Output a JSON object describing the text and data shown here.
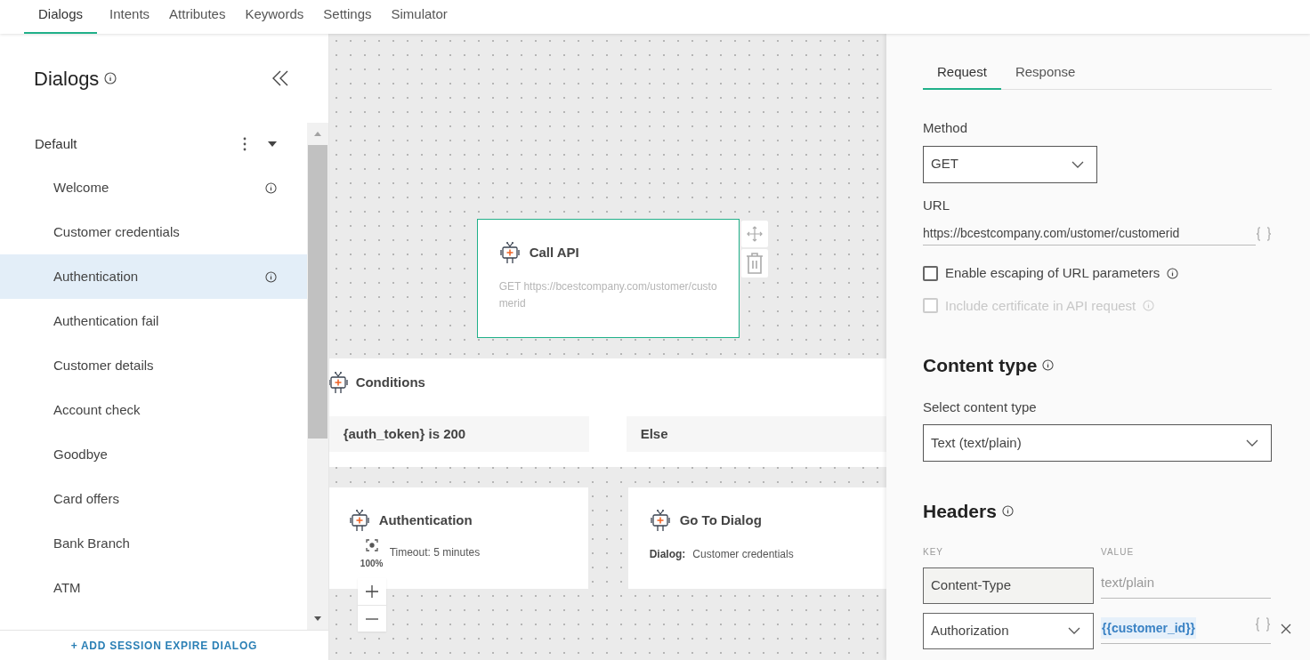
{
  "top_tabs": [
    {
      "label": "Dialogs",
      "selected": true
    },
    {
      "label": "Intents",
      "selected": false
    },
    {
      "label": "Attributes",
      "selected": false
    },
    {
      "label": "Keywords",
      "selected": false
    },
    {
      "label": "Settings",
      "selected": false
    },
    {
      "label": "Simulator",
      "selected": false
    }
  ],
  "sidebar": {
    "title": "Dialogs",
    "group": {
      "label": "Default",
      "expanded": true
    },
    "items": [
      {
        "label": "Welcome",
        "info": true,
        "selected": false
      },
      {
        "label": "Customer credentials",
        "info": false,
        "selected": false
      },
      {
        "label": "Authentication",
        "info": true,
        "selected": true
      },
      {
        "label": "Authentication fail",
        "info": false,
        "selected": false
      },
      {
        "label": "Customer details",
        "info": false,
        "selected": false
      },
      {
        "label": "Account check",
        "info": false,
        "selected": false
      },
      {
        "label": "Goodbye",
        "info": false,
        "selected": false
      },
      {
        "label": "Card offers",
        "info": false,
        "selected": false
      },
      {
        "label": "Bank Branch",
        "info": false,
        "selected": false
      },
      {
        "label": "ATM",
        "info": false,
        "selected": false
      }
    ],
    "add_button": "+ ADD SESSION EXPIRE DIALOG"
  },
  "canvas": {
    "nodes": [
      {
        "kind": "action",
        "title": "Call API",
        "text": "GET https://bcestcompany.com/ustomer/customerid",
        "selected": true
      },
      {
        "kind": "conditions",
        "title": "Conditions",
        "branches": [
          "{auth_token} is 200",
          "Else"
        ]
      },
      {
        "kind": "detail",
        "title": "Authentication",
        "text": "Timeout: 5 minutes"
      },
      {
        "kind": "goto",
        "title": "Go To Dialog",
        "label": "Dialog:",
        "value": "Customer credentials"
      }
    ],
    "zoom": "100%"
  },
  "panel": {
    "tabs": [
      {
        "label": "Request",
        "selected": true
      },
      {
        "label": "Response",
        "selected": false
      }
    ],
    "method": {
      "label": "Method",
      "value": "GET"
    },
    "url": {
      "label": "URL",
      "value": "https://bcestcompany.com/ustomer/customerid"
    },
    "options": [
      {
        "label": "Enable escaping of URL parameters",
        "checked": false,
        "disabled": false
      },
      {
        "label": "Include certificate in API request",
        "checked": false,
        "disabled": true
      }
    ],
    "content_type": {
      "heading": "Content type",
      "label": "Select content type",
      "value": "Text (text/plain)"
    },
    "headers": {
      "heading": "Headers",
      "columns": [
        "KEY",
        "VALUE"
      ],
      "rows": [
        {
          "kind": "fixed",
          "key": "Content-Type",
          "placeholder": "text/plain"
        },
        {
          "kind": "custom",
          "key": "Authorization",
          "value": "{{customer_id}}"
        }
      ]
    }
  }
}
